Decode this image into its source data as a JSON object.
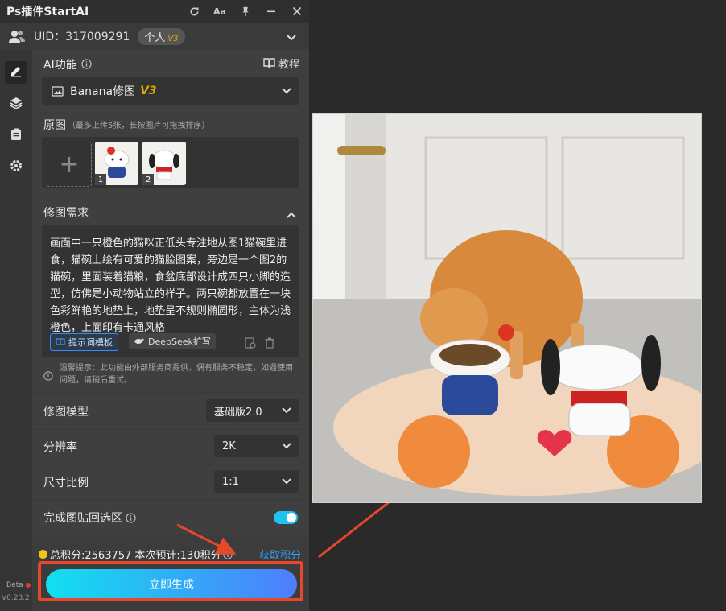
{
  "window": {
    "title": "Ps插件StartAI"
  },
  "titlebar_icons": [
    "refresh-icon",
    "font-size-icon",
    "pin-icon",
    "minimize-icon",
    "close-icon"
  ],
  "user": {
    "uid_label": "UID：317009291",
    "plan": "个人",
    "plan_badge": "V3"
  },
  "sidebar": {
    "items": [
      "edit-icon",
      "layers-icon",
      "clipboard-icon",
      "settings-icon"
    ],
    "beta": "Beta",
    "version": "V0.23.2"
  },
  "ai_function": {
    "label": "AI功能",
    "tutorial": "教程",
    "selected": "Banana修图",
    "selected_badge": "V3"
  },
  "source_images": {
    "label": "原图",
    "hint": "（最多上传5张，长按图片可拖拽排序）",
    "thumbs": [
      "1",
      "2"
    ]
  },
  "requirements": {
    "label": "修图需求",
    "text": "画面中一只橙色的猫咪正低头专注地从图1猫碗里进食，猫碗上绘有可爱的猫脸图案，旁边是一个图2的猫碗，里面装着猫粮，食盆底部设计成四只小脚的造型，仿佛是小动物站立的样子。两只碗都放置在一块色彩鲜艳的地垫上，地垫呈不规则椭圆形，主体为浅橙色，上面印有卡通风格",
    "template_btn": "提示词模板",
    "deepseek_btn": "DeepSeek扩写"
  },
  "notice": "温馨提示：此功能由外部服务商提供，偶有服务不稳定，如遇使用问题，请稍后重试。",
  "settings": [
    {
      "label": "修图模型",
      "value": "基础版2.0"
    },
    {
      "label": "分辨率",
      "value": "2K"
    },
    {
      "label": "尺寸比例",
      "value": "1:1"
    }
  ],
  "paste_back": {
    "label": "完成图贴回选区",
    "enabled": true
  },
  "points": {
    "text": "总积分:2563757  本次预计:130积分",
    "get_link": "获取积分"
  },
  "generate": {
    "label": "立即生成"
  },
  "colors": {
    "accent": "#1ec3ef",
    "highlight": "#e8472c",
    "badge": "#e0a800"
  }
}
